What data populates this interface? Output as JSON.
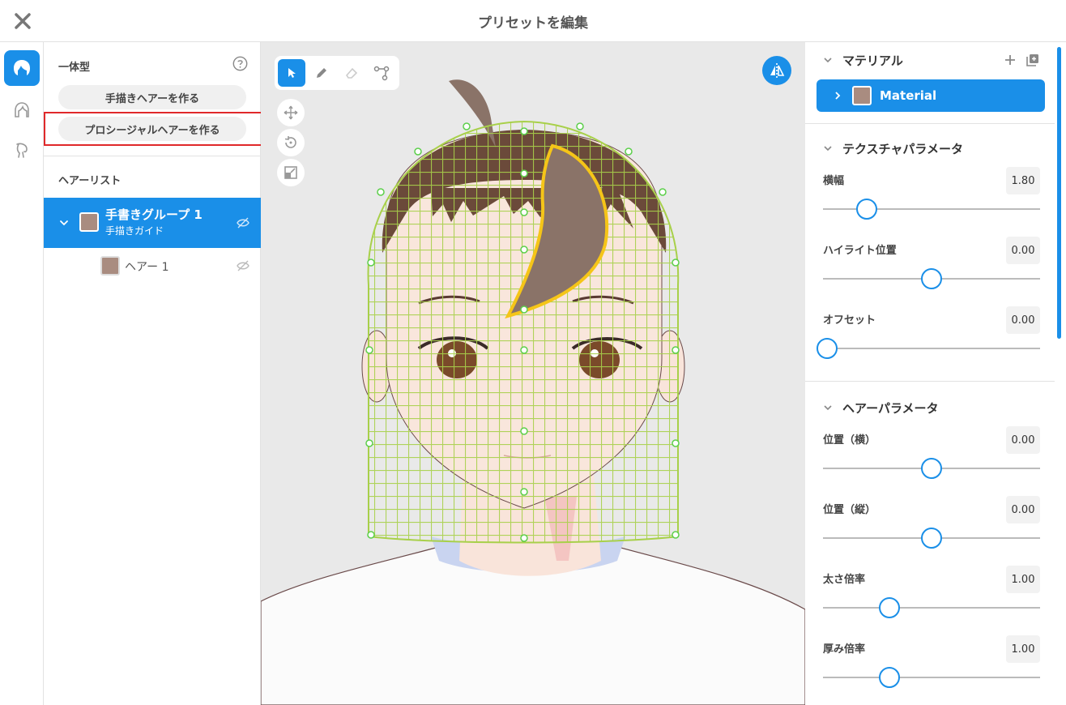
{
  "window": {
    "title": "プリセットを編集"
  },
  "left_panel": {
    "section_label": "一体型",
    "button_draw_hair": "手描きヘアーを作る",
    "button_procedural_hair": "プロシージャルヘアーを作る",
    "hair_list_label": "ヘアーリスト",
    "group": {
      "name": "手書きグループ 1",
      "subtitle": "手描きガイド",
      "color": "#a98c80"
    },
    "hair_item": {
      "name": "ヘアー 1",
      "color": "#a98c80"
    }
  },
  "viewport": {
    "tools": [
      "select-tool",
      "pen-tool",
      "eraser-tool",
      "path-tool"
    ],
    "active_tool": "select-tool",
    "side_tools": [
      "move-tool",
      "rotate-tool",
      "scale-tool"
    ]
  },
  "right_panel": {
    "material_header": "マテリアル",
    "material_item": {
      "name": "Material",
      "color": "#a98c80"
    },
    "texture_header": "テクスチャパラメータ",
    "texture_params": [
      {
        "label": "横幅",
        "value": "1.80",
        "fraction": 0.19
      },
      {
        "label": "ハイライト位置",
        "value": "0.00",
        "fraction": 0.5
      },
      {
        "label": "オフセット",
        "value": "0.00",
        "fraction": 0.0
      }
    ],
    "hair_header": "ヘアーパラメータ",
    "hair_params": [
      {
        "label": "位置（横）",
        "value": "0.00",
        "fraction": 0.5
      },
      {
        "label": "位置（縦）",
        "value": "0.00",
        "fraction": 0.5
      },
      {
        "label": "太さ倍率",
        "value": "1.00",
        "fraction": 0.3
      },
      {
        "label": "厚み倍率",
        "value": "1.00",
        "fraction": 0.3
      }
    ]
  },
  "colors": {
    "accent": "#1a8fe8",
    "highlight_box": "#e0282a",
    "guide_mesh": "#a8d04a",
    "hair_strand": "#8a7368"
  }
}
